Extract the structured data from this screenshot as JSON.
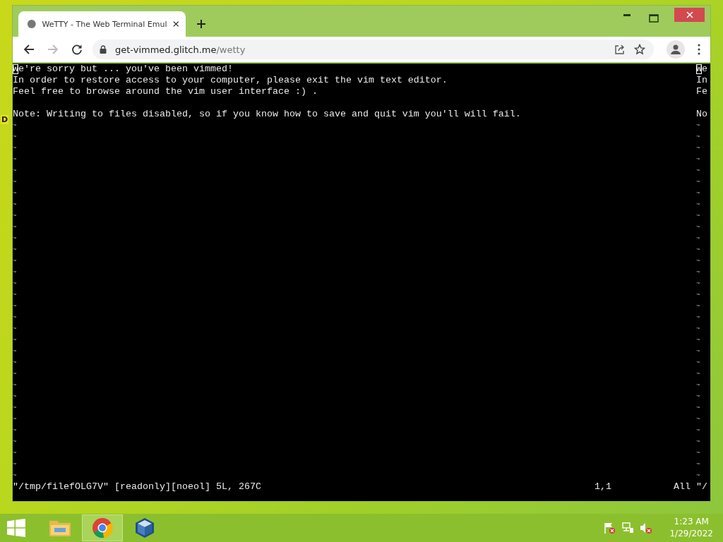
{
  "desktop": {
    "edge_text": "D"
  },
  "browser": {
    "tabs": [
      {
        "title": "WeTTY - The Web Terminal Emul",
        "selected": true
      }
    ],
    "nav": {
      "back_disabled": false,
      "forward_disabled": true
    },
    "address": {
      "host": "get-vimmed.glitch.me",
      "path": "/wetty"
    }
  },
  "terminal": {
    "cursor_visible": true,
    "left_lines": [
      {
        "kind": "text",
        "text": "We're sorry but ... you've been vimmed!"
      },
      {
        "kind": "text",
        "text": "In order to restore access to your computer, please exit the vim text editor."
      },
      {
        "kind": "text",
        "text": "Feel free to browse around the vim user interface :) ."
      },
      {
        "kind": "blank"
      },
      {
        "kind": "text",
        "text": "Note: Writing to files disabled, so if you know how to save and quit vim you'll will fail."
      },
      {
        "kind": "tilde",
        "text": "~"
      },
      {
        "kind": "tilde",
        "text": "~"
      },
      {
        "kind": "tilde",
        "text": "~"
      },
      {
        "kind": "tilde",
        "text": "~"
      },
      {
        "kind": "tilde",
        "text": "~"
      },
      {
        "kind": "tilde",
        "text": "~"
      },
      {
        "kind": "tilde",
        "text": "~"
      },
      {
        "kind": "tilde",
        "text": "~"
      },
      {
        "kind": "tilde",
        "text": "~"
      },
      {
        "kind": "tilde",
        "text": "~"
      },
      {
        "kind": "tilde",
        "text": "~"
      },
      {
        "kind": "tilde",
        "text": "~"
      },
      {
        "kind": "tilde",
        "text": "~"
      },
      {
        "kind": "tilde",
        "text": "~"
      },
      {
        "kind": "tilde",
        "text": "~"
      },
      {
        "kind": "tilde",
        "text": "~"
      },
      {
        "kind": "tilde",
        "text": "~"
      },
      {
        "kind": "tilde",
        "text": "~"
      },
      {
        "kind": "tilde",
        "text": "~"
      },
      {
        "kind": "tilde",
        "text": "~"
      },
      {
        "kind": "tilde",
        "text": "~"
      },
      {
        "kind": "tilde",
        "text": "~"
      },
      {
        "kind": "tilde",
        "text": "~"
      },
      {
        "kind": "tilde",
        "text": "~"
      },
      {
        "kind": "tilde",
        "text": "~"
      },
      {
        "kind": "tilde",
        "text": "~"
      },
      {
        "kind": "tilde",
        "text": "~"
      },
      {
        "kind": "tilde",
        "text": "~"
      },
      {
        "kind": "tilde",
        "text": "~"
      },
      {
        "kind": "tilde",
        "text": "~"
      },
      {
        "kind": "tilde",
        "text": "~"
      },
      {
        "kind": "tilde",
        "text": "~"
      }
    ],
    "right_lines": [
      {
        "kind": "text",
        "text": "We"
      },
      {
        "kind": "text",
        "text": "In"
      },
      {
        "kind": "text",
        "text": "Fe"
      },
      {
        "kind": "blank"
      },
      {
        "kind": "text",
        "text": "No"
      },
      {
        "kind": "tilde",
        "text": "~"
      },
      {
        "kind": "tilde",
        "text": "~"
      },
      {
        "kind": "tilde",
        "text": "~"
      },
      {
        "kind": "tilde",
        "text": "~"
      },
      {
        "kind": "tilde",
        "text": "~"
      },
      {
        "kind": "tilde",
        "text": "~"
      },
      {
        "kind": "tilde",
        "text": "~"
      },
      {
        "kind": "tilde",
        "text": "~"
      },
      {
        "kind": "tilde",
        "text": "~"
      },
      {
        "kind": "tilde",
        "text": "~"
      },
      {
        "kind": "tilde",
        "text": "~"
      },
      {
        "kind": "tilde",
        "text": "~"
      },
      {
        "kind": "tilde",
        "text": "~"
      },
      {
        "kind": "tilde",
        "text": "~"
      },
      {
        "kind": "tilde",
        "text": "~"
      },
      {
        "kind": "tilde",
        "text": "~"
      },
      {
        "kind": "tilde",
        "text": "~"
      },
      {
        "kind": "tilde",
        "text": "~"
      },
      {
        "kind": "tilde",
        "text": "~"
      },
      {
        "kind": "tilde",
        "text": "~"
      },
      {
        "kind": "tilde",
        "text": "~"
      },
      {
        "kind": "tilde",
        "text": "~"
      },
      {
        "kind": "tilde",
        "text": "~"
      },
      {
        "kind": "tilde",
        "text": "~"
      },
      {
        "kind": "tilde",
        "text": "~"
      },
      {
        "kind": "tilde",
        "text": "~"
      },
      {
        "kind": "tilde",
        "text": "~"
      },
      {
        "kind": "tilde",
        "text": "~"
      },
      {
        "kind": "tilde",
        "text": "~"
      },
      {
        "kind": "tilde",
        "text": "~"
      },
      {
        "kind": "tilde",
        "text": "~"
      },
      {
        "kind": "tilde",
        "text": "~"
      }
    ],
    "status": {
      "message": "\"/tmp/filefOLG7V\" [readonly][noeol] 5L, 267C",
      "ruler": "1,1",
      "position": "All",
      "right_pane_message": "\"/"
    }
  },
  "taskbar": {
    "apps": [
      {
        "kind": "folder",
        "selected": false
      },
      {
        "kind": "browser",
        "selected": true
      },
      {
        "kind": "cube",
        "selected": false
      }
    ],
    "clock": {
      "time": "1:23 AM",
      "date": "1/29/2022"
    }
  }
}
